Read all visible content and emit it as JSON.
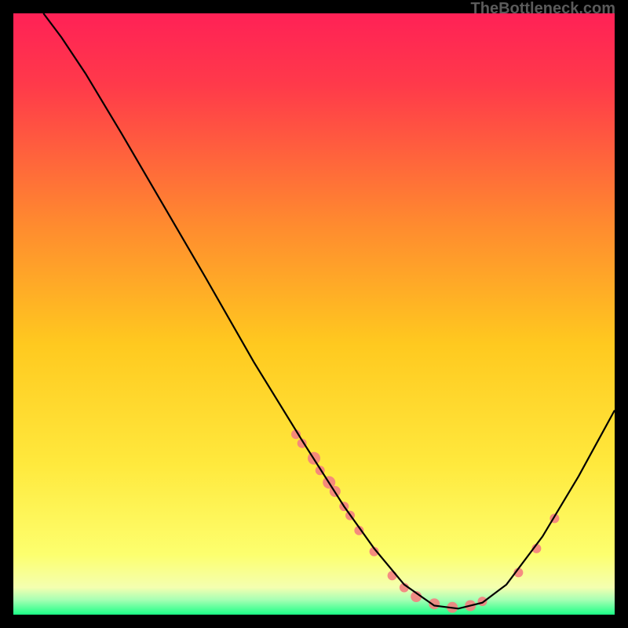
{
  "watermark": "TheBottleneck.com",
  "chart_data": {
    "type": "line",
    "title": "",
    "xlabel": "",
    "ylabel": "",
    "xlim": [
      0,
      100
    ],
    "ylim": [
      0,
      100
    ],
    "background": {
      "description": "vertical gradient red-orange-yellow-green top to bottom, bottom green band is very narrow",
      "stops": [
        {
          "pos": 0.0,
          "color": "#ff2156"
        },
        {
          "pos": 0.12,
          "color": "#ff3a4a"
        },
        {
          "pos": 0.35,
          "color": "#ff8a2f"
        },
        {
          "pos": 0.55,
          "color": "#ffc91f"
        },
        {
          "pos": 0.75,
          "color": "#ffe93d"
        },
        {
          "pos": 0.9,
          "color": "#fdff6e"
        },
        {
          "pos": 0.955,
          "color": "#f4ffb0"
        },
        {
          "pos": 0.975,
          "color": "#a8ffb4"
        },
        {
          "pos": 1.0,
          "color": "#1bff86"
        }
      ]
    },
    "series": [
      {
        "name": "bottleneck-curve",
        "description": "V-shaped black curve; steep descent from top-left, minimum near x~72, rises to right edge",
        "color": "#000000",
        "points": [
          {
            "x": 5,
            "y": 100
          },
          {
            "x": 8,
            "y": 96
          },
          {
            "x": 12,
            "y": 90
          },
          {
            "x": 18,
            "y": 80
          },
          {
            "x": 25,
            "y": 68
          },
          {
            "x": 32,
            "y": 56
          },
          {
            "x": 40,
            "y": 42
          },
          {
            "x": 48,
            "y": 29
          },
          {
            "x": 55,
            "y": 18
          },
          {
            "x": 60,
            "y": 11
          },
          {
            "x": 65,
            "y": 5
          },
          {
            "x": 70,
            "y": 1.5
          },
          {
            "x": 74,
            "y": 1
          },
          {
            "x": 78,
            "y": 2
          },
          {
            "x": 82,
            "y": 5
          },
          {
            "x": 88,
            "y": 13
          },
          {
            "x": 94,
            "y": 23
          },
          {
            "x": 100,
            "y": 34
          }
        ]
      }
    ],
    "scatter": {
      "name": "data-point-markers",
      "description": "salmon-pink circular markers along the lower part of the curve",
      "color": "#f48080",
      "radius_base": 6,
      "points": [
        {
          "x": 47,
          "y": 30,
          "r": 6
        },
        {
          "x": 48,
          "y": 28.5,
          "r": 6
        },
        {
          "x": 50,
          "y": 26,
          "r": 8
        },
        {
          "x": 51,
          "y": 24,
          "r": 6
        },
        {
          "x": 52.5,
          "y": 22,
          "r": 8
        },
        {
          "x": 53.5,
          "y": 20.5,
          "r": 7
        },
        {
          "x": 55,
          "y": 18,
          "r": 6
        },
        {
          "x": 56,
          "y": 16.5,
          "r": 6
        },
        {
          "x": 57.5,
          "y": 14,
          "r": 6
        },
        {
          "x": 60,
          "y": 10.5,
          "r": 6
        },
        {
          "x": 63,
          "y": 6.5,
          "r": 6
        },
        {
          "x": 65,
          "y": 4.5,
          "r": 6
        },
        {
          "x": 67,
          "y": 3,
          "r": 7
        },
        {
          "x": 70,
          "y": 1.8,
          "r": 7
        },
        {
          "x": 73,
          "y": 1.2,
          "r": 7
        },
        {
          "x": 76,
          "y": 1.5,
          "r": 7
        },
        {
          "x": 78,
          "y": 2.2,
          "r": 6
        },
        {
          "x": 84,
          "y": 7,
          "r": 6
        },
        {
          "x": 87,
          "y": 11,
          "r": 6
        },
        {
          "x": 90,
          "y": 16,
          "r": 6
        }
      ]
    }
  }
}
